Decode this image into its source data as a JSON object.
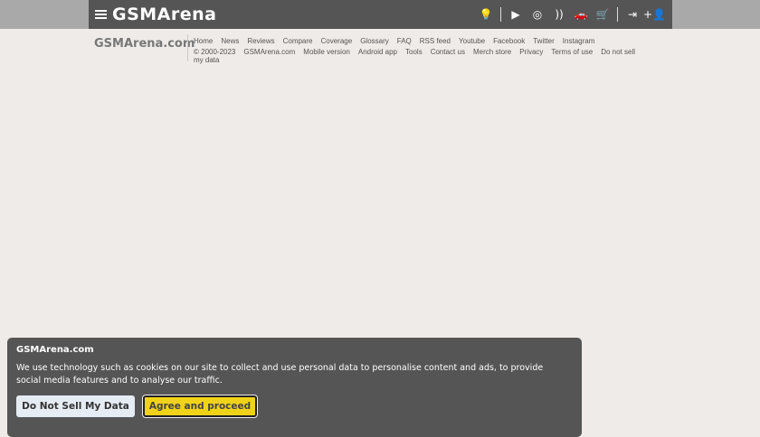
{
  "header": {
    "logo": "GSMArena",
    "icons": [
      "lightbulb-icon",
      "youtube-icon",
      "instagram-icon",
      "rss-icon",
      "car-icon",
      "cart-icon",
      "login-icon",
      "add-user-icon"
    ]
  },
  "footer": {
    "logo": "GSMArena.com",
    "row1": [
      "Home",
      "News",
      "Reviews",
      "Compare",
      "Coverage",
      "Glossary",
      "FAQ",
      "RSS feed",
      "Youtube",
      "Facebook",
      "Twitter",
      "Instagram"
    ],
    "row2": [
      "© 2000-2023",
      "GSMArena.com",
      "Mobile version",
      "Android app",
      "Tools",
      "Contact us",
      "Merch store",
      "Privacy",
      "Terms of use",
      "Do not sell my data"
    ]
  },
  "cookie": {
    "logo": "GSMArena.com",
    "text": "We use technology such as cookies on our site to collect and use personal data to personalise content and ads, to provide social media features and to analyse our traffic.",
    "do_not_sell": "Do Not Sell My Data",
    "agree": "Agree and proceed"
  }
}
